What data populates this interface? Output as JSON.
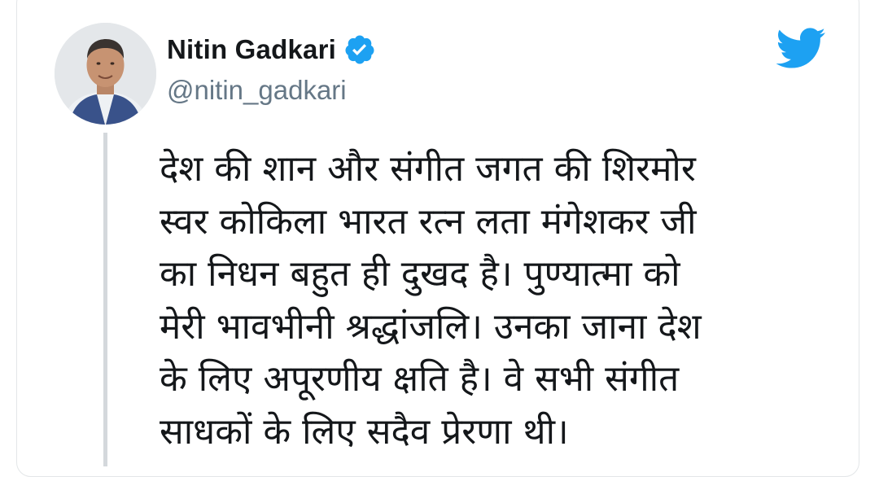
{
  "colors": {
    "twitter_blue": "#1da1f2",
    "text_primary": "#14171a",
    "text_secondary": "#657786",
    "thread_line": "#d4d8dc"
  },
  "author": {
    "display_name": "Nitin Gadkari",
    "handle": "@nitin_gadkari",
    "verified": true,
    "avatar_icon": "profile-photo",
    "verified_icon": "verified-badge-icon"
  },
  "brand_icon": "twitter-bird-icon",
  "tweet": {
    "lines": [
      "देश की शान और संगीत जगत की शिरमोर",
      "स्वर कोकिला भारत रत्न लता मंगेशकर जी",
      "का निधन बहुत ही दुखद है। पुण्यात्मा को",
      "मेरी भावभीनी श्रद्धांजलि। उनका जाना देश",
      "के लिए अपूरणीय क्षति है। वे सभी संगीत",
      "साधकों के लिए सदैव प्रेरणा थी।"
    ]
  }
}
